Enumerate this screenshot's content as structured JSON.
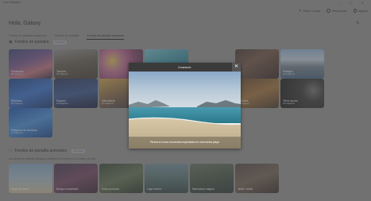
{
  "window": {
    "title": "Live Wallpaper",
    "controls": "— ▢ ✕"
  },
  "toolbar": {
    "create_label": "Volver a crear",
    "select_label": "Seleccionar",
    "settings_label": "Ajustes"
  },
  "header": {
    "greeting": "Hola,  Galaxy"
  },
  "tabs": [
    {
      "label": "Fondos de pantalla dinámicos"
    },
    {
      "label": "Fondos de pantalla"
    },
    {
      "label": "Fondos de pantalla animados"
    }
  ],
  "sections": {
    "wallpapers": {
      "title": "Fondos de pantalla",
      "pill": "Ver todos"
    },
    "animated": {
      "title": "Fondos de pantalla animados",
      "pill": "Ver todos",
      "hint": "Los fondos de pantalla animados cambian y se mueven con el ratón y el reloj."
    }
  },
  "wallpaper_tiles": [
    {
      "label": "Destacado",
      "count": "88 imágenes"
    },
    {
      "label": "Templos",
      "count": "36 imágenes"
    },
    {
      "label": "",
      "count": ""
    },
    {
      "label": "",
      "count": ""
    },
    {
      "label": "",
      "count": ""
    },
    {
      "label": "",
      "count": ""
    },
    {
      "label": "Paisajes",
      "count": "32 imágenes"
    },
    {
      "label": "Windows",
      "count": "18 imágenes"
    },
    {
      "label": "Espacio",
      "count": "24 imágenes"
    },
    {
      "label": "Minimalista",
      "count": "16 imágenes"
    },
    {
      "label": "",
      "count": ""
    },
    {
      "label": "",
      "count": ""
    },
    {
      "label": "Animales",
      "count": "28 imágenes"
    },
    {
      "label": "Tema oscuro",
      "count": "22 imágenes"
    },
    {
      "label": "Imágenes de windows",
      "count": "12 imágenes"
    }
  ],
  "animated_tiles": [
    {
      "label": "Playa de arena"
    },
    {
      "label": "Bosque encantado"
    },
    {
      "label": "Selva profunda"
    },
    {
      "label": "Lago sereno"
    },
    {
      "label": "Naturaleza mágica"
    },
    {
      "label": "Jardín otoñal"
    }
  ],
  "dialog": {
    "title": "Amanecer",
    "close": "✕",
    "caption": "Pierna en cinco recuerdos especiales en una bonita playa"
  }
}
